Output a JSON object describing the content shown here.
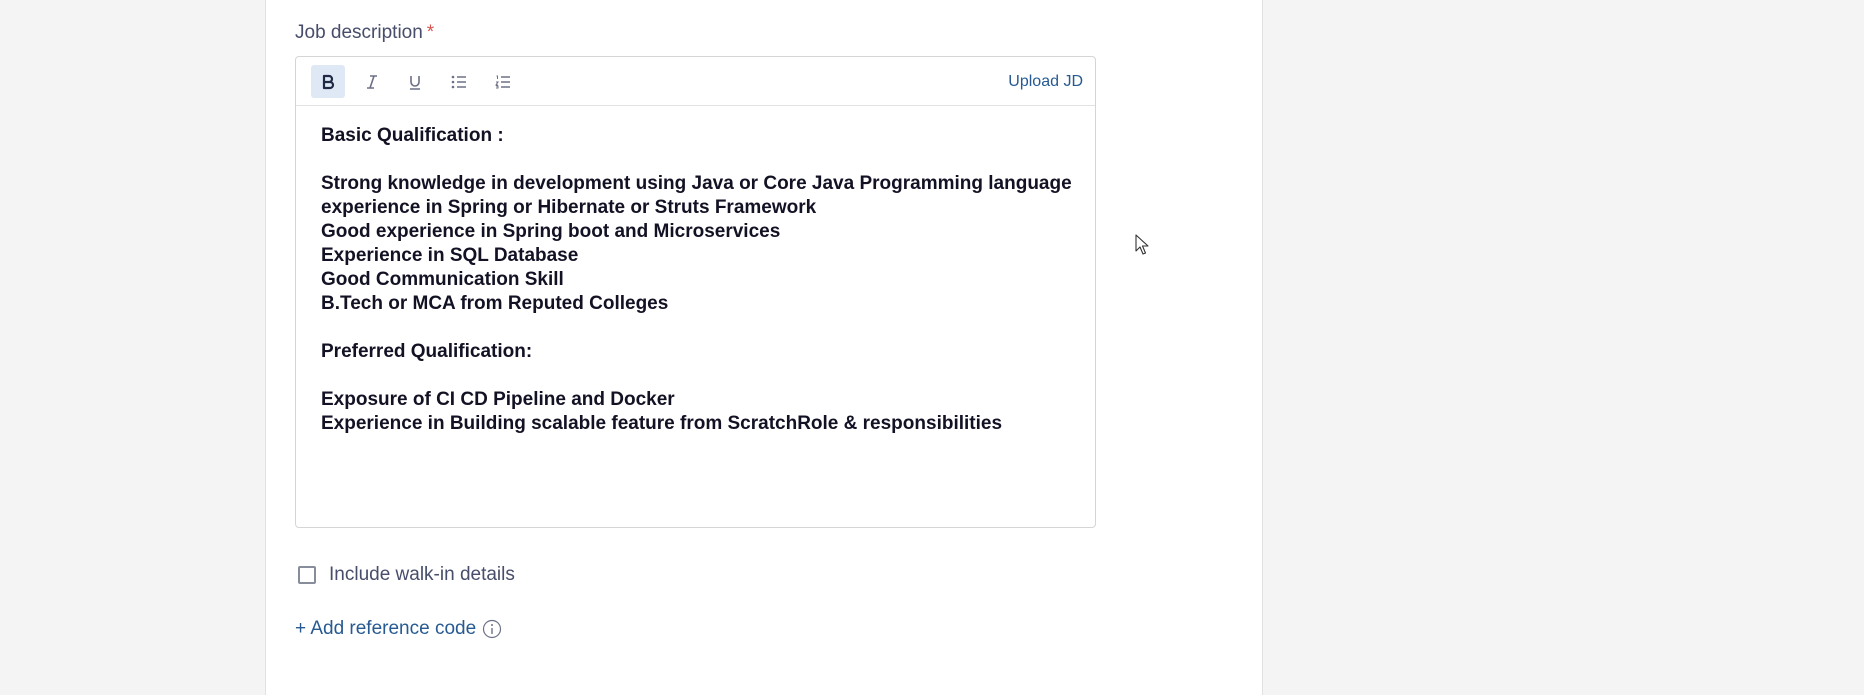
{
  "job_description": {
    "label": "Job description",
    "required_marker": "*",
    "toolbar": {
      "bold_icon": "bold-icon",
      "italic_icon": "italic-icon",
      "underline_icon": "underline-icon",
      "bullet_list_icon": "bullet-list-icon",
      "numbered_list_icon": "numbered-list-icon",
      "upload_label": "Upload JD"
    },
    "content_lines": [
      "Basic Qualification :",
      "",
      "Strong knowledge in development using Java or Core Java Programming language",
      "experience in Spring or Hibernate or Struts Framework",
      "Good experience in Spring boot and Microservices",
      "Experience in SQL Database",
      "Good Communication Skill",
      "B.Tech or MCA from Reputed Colleges",
      "",
      "Preferred Qualification:",
      "",
      "Exposure of CI CD Pipeline and Docker",
      "Experience in Building scalable feature from ScratchRole & responsibilities"
    ]
  },
  "walkin": {
    "label": "Include walk-in details",
    "checked": false
  },
  "reference_code": {
    "link_label": "+ Add reference code",
    "icon": "info-icon"
  },
  "colors": {
    "accent": "#275a91",
    "label": "#474d6a",
    "text": "#121224"
  }
}
